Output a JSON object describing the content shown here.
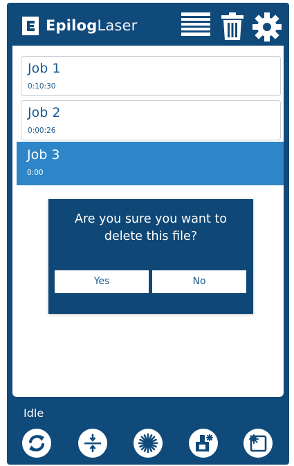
{
  "app": {
    "brand_bold": "Epilog",
    "brand_light": "Laser"
  },
  "header": {
    "icons": [
      "list-icon",
      "trash-icon",
      "gear-icon"
    ]
  },
  "jobs": [
    {
      "name": "Job 1",
      "time": "0:10:30",
      "selected": false
    },
    {
      "name": "Job 2",
      "time": "0:00:26",
      "selected": false
    },
    {
      "name": "Job 3",
      "time": "0:00",
      "selected": true
    }
  ],
  "dialog": {
    "message_line1": "Are you sure you want to",
    "message_line2": "delete this file?",
    "yes_label": "Yes",
    "no_label": "No"
  },
  "footer": {
    "status": "Idle",
    "buttons": [
      "refresh-icon",
      "focus-icon",
      "laser-icon",
      "job-settings-icon",
      "home-icon"
    ]
  },
  "colors": {
    "primary": "#104a7b",
    "selected_row": "#2e86c9",
    "text_blue": "#1a5a8e"
  }
}
